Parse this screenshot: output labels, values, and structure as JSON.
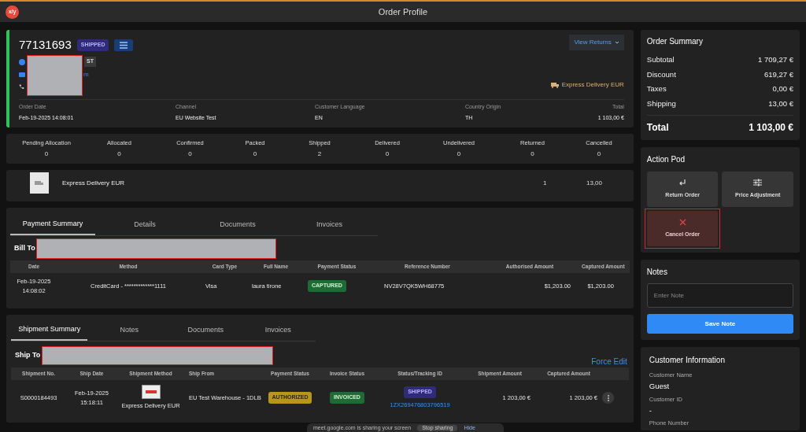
{
  "window": {
    "title": "Order Profile",
    "logo": "x/y"
  },
  "order": {
    "number": "77131693",
    "status": {
      "label": "SHIPPED",
      "kind": "shipped"
    },
    "view_returns": "View Returns",
    "tag_fragment": "ST",
    "email_fragment": "m",
    "delivery": "Express Delivery EUR",
    "fields": [
      {
        "label": "Order Date",
        "value": "Feb-19-2025 14:08:01"
      },
      {
        "label": "Channel",
        "value": "EU Website Test"
      },
      {
        "label": "Customer Language",
        "value": "EN"
      },
      {
        "label": "Country Origin",
        "value": "TH"
      },
      {
        "label": "Total",
        "value": "1 103,00 €"
      }
    ]
  },
  "counts": [
    {
      "label": "Pending Allocation",
      "value": "0"
    },
    {
      "label": "Allocated",
      "value": "0"
    },
    {
      "label": "Confirmed",
      "value": "0"
    },
    {
      "label": "Packed",
      "value": "0"
    },
    {
      "label": "Shipped",
      "value": "2"
    },
    {
      "label": "Delivered",
      "value": "0"
    },
    {
      "label": "Undelivered",
      "value": "0"
    },
    {
      "label": "Returned",
      "value": "0"
    },
    {
      "label": "Cancelled",
      "value": "0"
    }
  ],
  "shipping_line": {
    "label": "Express Delivery EUR",
    "column_3": "1",
    "column_4": "13,00"
  },
  "payment": {
    "tabs": [
      {
        "label": "Payment Summary",
        "selected": true
      },
      {
        "label": "Details",
        "selected": false
      },
      {
        "label": "Documents",
        "selected": false
      },
      {
        "label": "Invoices",
        "selected": false
      }
    ],
    "bill_to": "Bill To",
    "columns": [
      "Date",
      "Method",
      "Card Type",
      "Full Name",
      "Payment Status",
      "Reference Number",
      "Authorised Amount",
      "Captured Amount"
    ],
    "rows": [
      {
        "date": [
          "Feb-19-2025",
          "14:08:02"
        ],
        "method": "CreditCard - *************1111",
        "card_type": "Visa",
        "full_name": "laura tirone",
        "status": {
          "label": "CAPTURED",
          "kind": "success"
        },
        "reference": "NV28V7QK5WH68775",
        "authorised": "$1,203.00",
        "captured": "$1,203.00"
      }
    ]
  },
  "shipment": {
    "tabs": [
      {
        "label": "Shipment Summary",
        "selected": true
      },
      {
        "label": "Notes",
        "selected": false
      },
      {
        "label": "Documents",
        "selected": false
      },
      {
        "label": "Invoices",
        "selected": false
      }
    ],
    "ship_to": "Ship To",
    "force_edit": "Force Edit",
    "columns": [
      "Shipment No.",
      "Ship Date",
      "Shipment Method",
      "Ship From",
      "Payment Status",
      "Invoice Status",
      "Status/Tracking ID",
      "Shipment Amount",
      "Captured Amount"
    ],
    "rows": [
      {
        "number": "S0000184493",
        "date": [
          "Feb-19-2025",
          "15:18:11"
        ],
        "method": "Express Delivery EUR",
        "ship_from": "EU Test Warehouse - 1DLB",
        "payment_status": {
          "label": "AUTHORIZED",
          "kind": "warning"
        },
        "invoice_status": {
          "label": "INVOICED",
          "kind": "success"
        },
        "status": {
          "label": "SHIPPED",
          "kind": "shipped"
        },
        "tracking": "1ZX269476803796519",
        "amount": "1 203,00 €",
        "captured": "1 203,00 €"
      }
    ]
  },
  "summary": {
    "title": "Order Summary",
    "lines": [
      {
        "label": "Subtotal",
        "value": "1 709,27 €"
      },
      {
        "label": "Discount",
        "value": "619,27 €"
      },
      {
        "label": "Taxes",
        "value": "0,00 €"
      },
      {
        "label": "Shipping",
        "value": "13,00 €"
      }
    ],
    "total": {
      "label": "Total",
      "value": "1 103,00 €"
    }
  },
  "action_pod": {
    "title": "Action Pod",
    "actions": [
      {
        "label": "Return Order",
        "kind": "return",
        "highlighted": false
      },
      {
        "label": "Price Adjustment",
        "kind": "adjust",
        "highlighted": false
      },
      {
        "label": "Cancel Order",
        "kind": "cancel",
        "highlighted": true
      }
    ]
  },
  "notes": {
    "title": "Notes",
    "placeholder": "Enter Note",
    "button": "Save Note"
  },
  "customer": {
    "title": "Customer Information",
    "fields": [
      {
        "label": "Customer Name",
        "value": "Guest"
      },
      {
        "label": "Customer ID",
        "value": "-"
      }
    ],
    "cut_label": "Phone Number"
  },
  "share_bar": {
    "message": "meet.google.com is sharing your screen",
    "stop": "Stop sharing",
    "hide": "Hide"
  }
}
